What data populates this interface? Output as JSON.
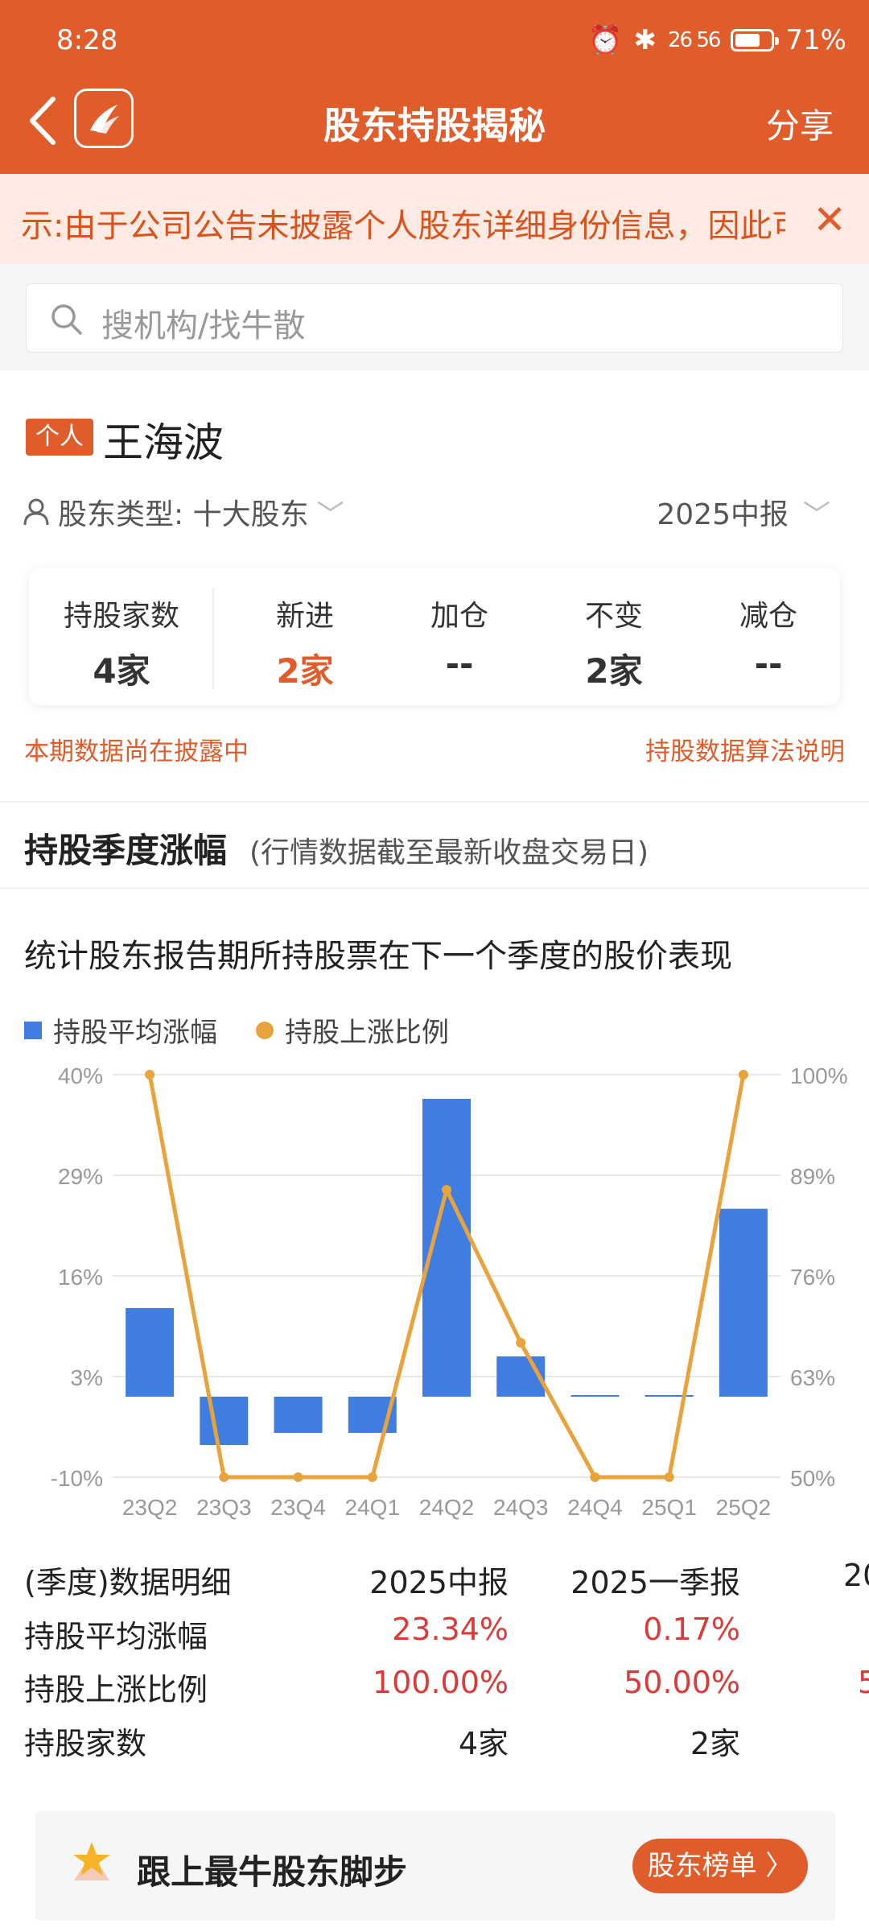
{
  "status": {
    "time": "8:28",
    "battery": "71%",
    "battery_level": 0.71,
    "network": "26 56"
  },
  "header": {
    "title": "股东持股揭秘",
    "share": "分享"
  },
  "notice": {
    "text": "示:由于公司公告未披露个人股东详细身份信息，因此可"
  },
  "search": {
    "placeholder": "搜机构/找牛散"
  },
  "profile": {
    "tag": "个人",
    "name": "王海波",
    "type_label": "股东类型: 十大股东",
    "period": "2025中报"
  },
  "stats": [
    {
      "label": "持股家数",
      "value": "4家"
    },
    {
      "label": "新进",
      "value": "2家"
    },
    {
      "label": "加仓",
      "value": "--"
    },
    {
      "label": "不变",
      "value": "2家"
    },
    {
      "label": "减仓",
      "value": "--"
    }
  ],
  "links": {
    "disclosing": "本期数据尚在披露中",
    "algorithm": "持股数据算法说明"
  },
  "section": {
    "title": "持股季度涨幅",
    "subtitle": "(行情数据截至最新收盘交易日)",
    "description": "统计股东报告期所持股票在下一个季度的股价表现"
  },
  "chart_data": {
    "type": "bar",
    "categories": [
      "23Q2",
      "23Q3",
      "23Q4",
      "24Q1",
      "24Q2",
      "24Q3",
      "24Q4",
      "25Q1",
      "25Q2"
    ],
    "series": [
      {
        "name": "持股平均涨幅",
        "type": "bar",
        "axis": "left",
        "color": "#3f7de0",
        "values": [
          11,
          -6,
          -4.5,
          -4.5,
          37,
          5,
          0.1,
          0.17,
          23.34
        ]
      },
      {
        "name": "持股上涨比例",
        "type": "line",
        "axis": "right",
        "color": "#e8a33d",
        "values": [
          100,
          50,
          50,
          50,
          85.7,
          66.7,
          50,
          50,
          100
        ]
      }
    ],
    "left_axis": {
      "ticks": [
        "40%",
        "29%",
        "16%",
        "3%",
        "-10%"
      ],
      "ylim": [
        -10,
        40
      ]
    },
    "right_axis": {
      "ticks": [
        "100%",
        "89%",
        "76%",
        "63%",
        "50%"
      ],
      "ylim": [
        50,
        100
      ]
    },
    "grid": true
  },
  "table": {
    "header": [
      "(季度)数据明细",
      "2025中报",
      "2025一季报",
      "20"
    ],
    "rows": [
      {
        "label": "持股平均涨幅",
        "values": [
          "23.34%",
          "0.17%",
          ""
        ]
      },
      {
        "label": "持股上涨比例",
        "values": [
          "100.00%",
          "50.00%",
          "5"
        ]
      },
      {
        "label": "持股家数",
        "values": [
          "4家",
          "2家",
          ""
        ]
      }
    ]
  },
  "banner": {
    "text": "跟上最牛股东脚步",
    "button": "股东榜单 〉"
  },
  "colors": {
    "brand": "#e05c2a",
    "bar": "#3f7de0",
    "line": "#e8a33d",
    "positive": "#d93a3a"
  }
}
